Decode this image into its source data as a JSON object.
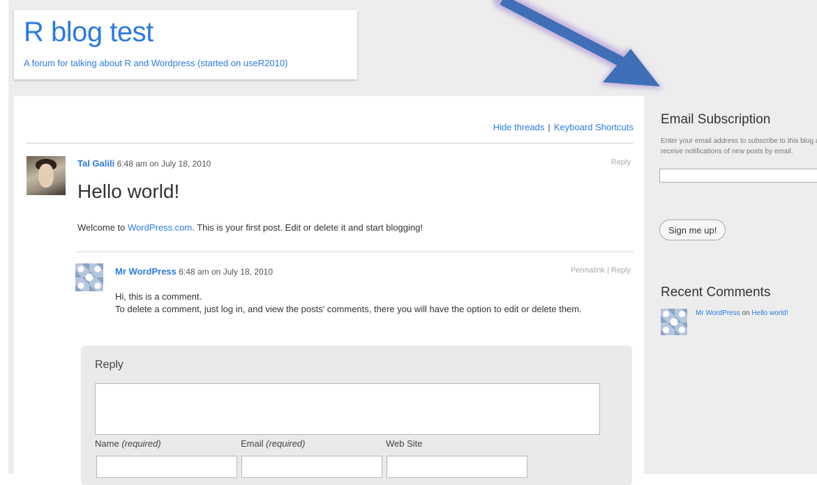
{
  "site": {
    "title": "R blog test",
    "description": "A forum for talking about R and Wordpress (started on useR2010)"
  },
  "thread_tools": {
    "hide_threads": "Hide threads",
    "separator": "|",
    "keyboard_shortcuts": "Keyboard Shortcuts"
  },
  "post": {
    "author": "Tal Galili",
    "timestamp": "6:48 am on July 18, 2010",
    "reply_label": "Reply",
    "title": "Hello world!",
    "body_prefix": "Welcome to ",
    "body_link": "WordPress.com",
    "body_suffix": ". This is your first post. Edit or delete it and start blogging!"
  },
  "comment": {
    "author": "Mr WordPress",
    "timestamp": "6:48 am on July 18, 2010",
    "actions": "Permalink | Reply",
    "line1": "Hi, this is a comment.",
    "line2": "To delete a comment, just log in, and view the posts' comments, there you will have the option to edit or delete them."
  },
  "reply_form": {
    "title": "Reply",
    "name_label": "Name",
    "email_label": "Email",
    "required_label": "(required)",
    "website_label": "Web Site"
  },
  "sidebar": {
    "email_title": "Email Subscription",
    "email_description": "Enter your email address to subscribe to this blog and receive notifications of new posts by email.",
    "signup_button": "Sign me up!",
    "recent_title": "Recent Comments",
    "recent_author": "Mr WordPress",
    "recent_on": " on ",
    "recent_post": "Hello world!"
  },
  "colors": {
    "link": "#2a7ae2",
    "background": "#ededed",
    "arrow": "#3f6fb6"
  }
}
